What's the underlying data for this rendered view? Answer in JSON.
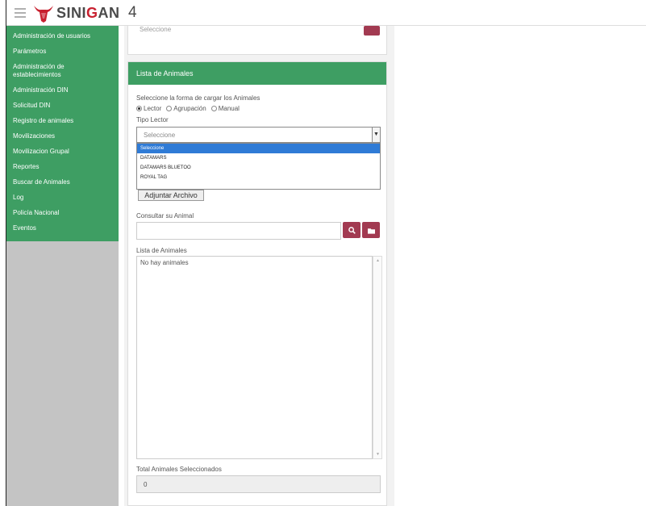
{
  "header": {
    "brand_prefix": "SINI",
    "brand_highlight": "G",
    "brand_suffix": "AN",
    "version": "4"
  },
  "sidebar": {
    "items": [
      {
        "label": "Administración de usuarios"
      },
      {
        "label": "Parámetros"
      },
      {
        "label": "Administración de establecimientos"
      },
      {
        "label": "Administración DIN"
      },
      {
        "label": "Solicitud DIN"
      },
      {
        "label": "Registro de animales"
      },
      {
        "label": "Movilizaciones"
      },
      {
        "label": "Movilizacion Grupal"
      },
      {
        "label": "Reportes"
      },
      {
        "label": "Buscar de Animales"
      },
      {
        "label": "Log"
      },
      {
        "label": "Policía Nacional"
      },
      {
        "label": "Eventos"
      }
    ]
  },
  "previous_panel": {
    "text": "Seleccione"
  },
  "panel": {
    "title": "Lista de Animales",
    "load_mode_label": "Seleccione la forma de cargar los Animales",
    "radio_options": [
      {
        "label": "Lector",
        "checked": true
      },
      {
        "label": "Agrupación",
        "checked": false
      },
      {
        "label": "Manual",
        "checked": false
      }
    ],
    "reader_type_label": "Tipo Lector",
    "reader_select": {
      "value": "Seleccione",
      "options": [
        "Seleccione",
        "DATAMARS",
        "DATAMARS BLUETOO",
        "ROYAL TAG"
      ]
    },
    "attach_button": "Adjuntar Archivo",
    "search_label": "Consultar su Animal",
    "animal_list_label": "Lista de Animales",
    "animal_list_empty": "No hay animales",
    "total_label": "Total Animales Seleccionados",
    "total_value": "0"
  },
  "colors": {
    "green": "#3e9e63",
    "maroon": "#a23a51",
    "sidebar_gray": "#c4c4c4",
    "select_highlight": "#2f7bd6"
  }
}
